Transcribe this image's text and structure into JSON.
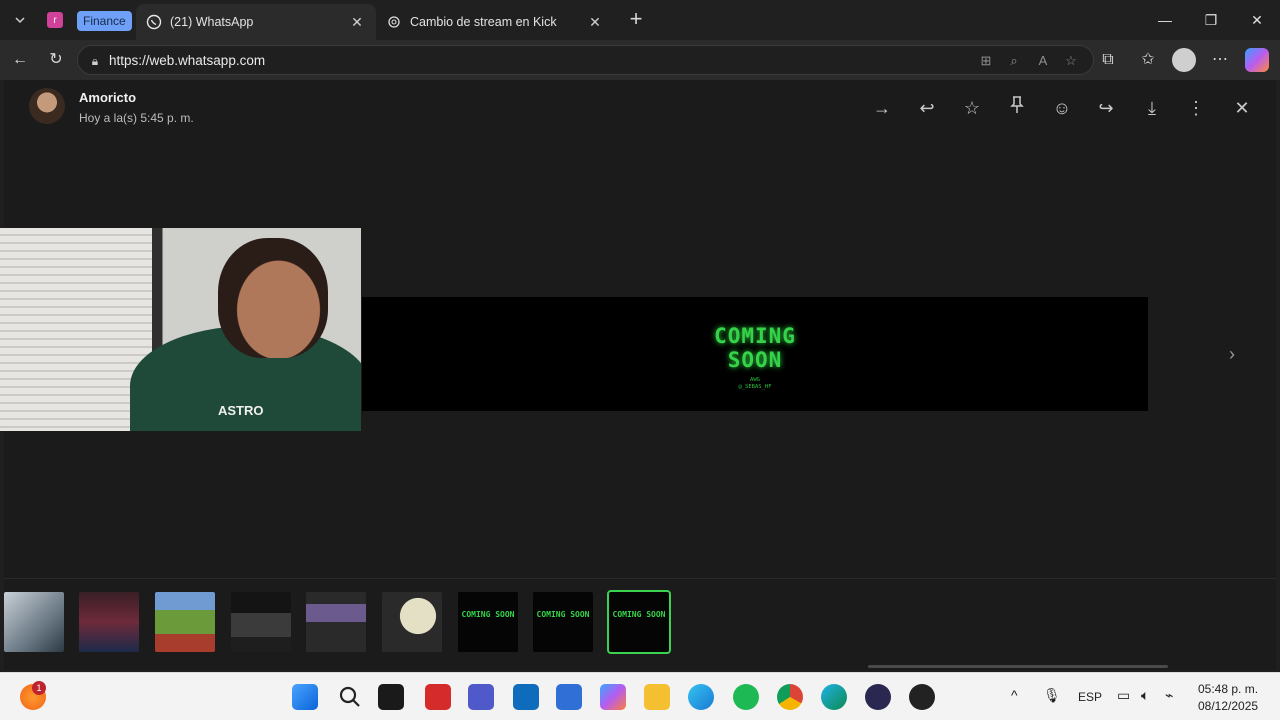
{
  "browser": {
    "tab_group_letter": "r",
    "tab_group_label": "Finance",
    "tabs": [
      {
        "title": "(21) WhatsApp",
        "icon": "whatsapp-icon",
        "active": true
      },
      {
        "title": "Cambio de stream en Kick",
        "icon": "openai-icon",
        "active": false
      }
    ],
    "url": "https://web.whatsapp.com"
  },
  "viewer": {
    "sender_name": "Amoricto",
    "sent_time": "Hoy a la(s) 5:45 p. m.",
    "media_title_line1": "COMING",
    "media_title_line2": "SOON",
    "media_sub1": "AWG",
    "media_sub2": "@_SEBAS_HF",
    "webcam_shirt_text": "ASTRO",
    "thumb_coming_soon": "COMING SOON",
    "thumb_count": 9,
    "selected_thumb_index": 8
  },
  "taskbar": {
    "notification_count": "1",
    "language": "ESP",
    "time": "05:48 p. m.",
    "date": "08/12/2025"
  },
  "colors": {
    "accent_green": "#35d24a",
    "tab_group": "#6ea0f7"
  }
}
